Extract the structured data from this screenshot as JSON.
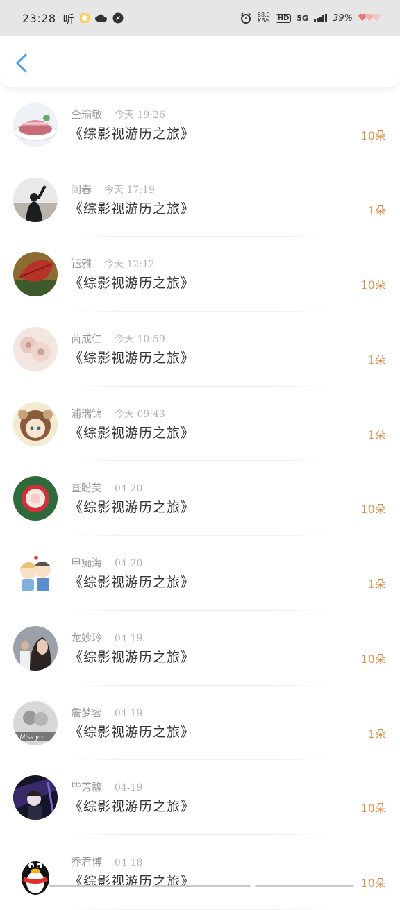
{
  "status_bar": {
    "time": "23:28",
    "app_text": "听",
    "net_speed_value": "68.0",
    "net_speed_unit": "KB/s",
    "hd": "HD",
    "network": "5G",
    "battery": "39%"
  },
  "header": {
    "back_icon": "chevron-left-icon",
    "accent_color": "#4a9fe0"
  },
  "list": {
    "amount_color": "#e0873f",
    "items": [
      {
        "name": "仝瑜敏",
        "time": "今天 19:26",
        "title": "《综影视游历之旅》",
        "amount": "10朵",
        "avatar": "food-plate"
      },
      {
        "name": "阎春",
        "time": "今天 17:19",
        "title": "《综影视游历之旅》",
        "amount": "1朵",
        "avatar": "person-silhouette"
      },
      {
        "name": "钰雅",
        "time": "今天 12:12",
        "title": "《综影视游历之旅》",
        "amount": "10朵",
        "avatar": "red-leaf"
      },
      {
        "name": "芮成仁",
        "time": "今天 10:59",
        "title": "《综影视游历之旅》",
        "amount": "1朵",
        "avatar": "soft-flowers"
      },
      {
        "name": "浦瑞锦",
        "time": "今天 09:43",
        "title": "《综影视游历之旅》",
        "amount": "1朵",
        "avatar": "anime-girl"
      },
      {
        "name": "查盼芙",
        "time": "04-20",
        "title": "《综影视游历之旅》",
        "amount": "10朵",
        "avatar": "rose"
      },
      {
        "name": "甲痴海",
        "time": "04-20",
        "title": "《综影视游历之旅》",
        "amount": "1朵",
        "avatar": "cartoon-couple"
      },
      {
        "name": "龙妙玲",
        "time": "04-19",
        "title": "《综影视游历之旅》",
        "amount": "10朵",
        "avatar": "woman-portrait"
      },
      {
        "name": "詹梦容",
        "time": "04-19",
        "title": "《综影视游历之旅》",
        "amount": "1朵",
        "avatar": "mono-couple"
      },
      {
        "name": "毕芳馥",
        "time": "04-19",
        "title": "《综影视游历之旅》",
        "amount": "10朵",
        "avatar": "dark-anime"
      },
      {
        "name": "乔君博",
        "time": "04-18",
        "title": "《综影视游历之旅》",
        "amount": "10朵",
        "avatar": "qq-penguin"
      }
    ]
  }
}
